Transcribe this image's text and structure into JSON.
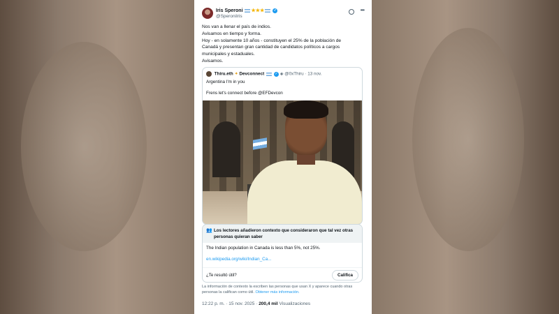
{
  "author": {
    "name": "Iris Speroni",
    "handle": "@SperoniIris"
  },
  "tweet_lines": [
    "Nos van a llenar el país de indios.",
    "Avisamos en tiempo y forma.",
    "Hoy - en solamente 10 años - constituyen el 25% de la población de",
    "Canadá y presentan gran cantidad de candidatos políticos a cargos",
    "municipales y estaduales.",
    "Avisamos."
  ],
  "quote": {
    "name": "Thiru.eth",
    "name_suffix": "Devconnect",
    "handle": "@0xThiru",
    "date": "· 13 nov.",
    "line1": "Argentina I'm in you",
    "line2": "Frens let's connect before @EFDevcon"
  },
  "community_note": {
    "title": "Los lectores añadieron contexto que consideraron que tal vez otras personas quieran saber",
    "body": "The Indian population in Canada is less than 5%, not 25%.",
    "link": "en.wikipedia.org/wiki/Indian_Ca...",
    "helpful_question": "¿Te resultó útil?",
    "rate_button": "Califica"
  },
  "disclaimer": {
    "text": "La información de contexto la escriben las personas que usan X y aparece cuando otras personas la califican como útil.",
    "link": "Obtener más información."
  },
  "meta": {
    "time": "12:22 p. m. · 15 nov. 2025 ·",
    "views": "200,4 mil",
    "views_label": "Visualizaciones"
  },
  "colors": {
    "accent": "#1d9bf0",
    "secondary_text": "#536471"
  }
}
